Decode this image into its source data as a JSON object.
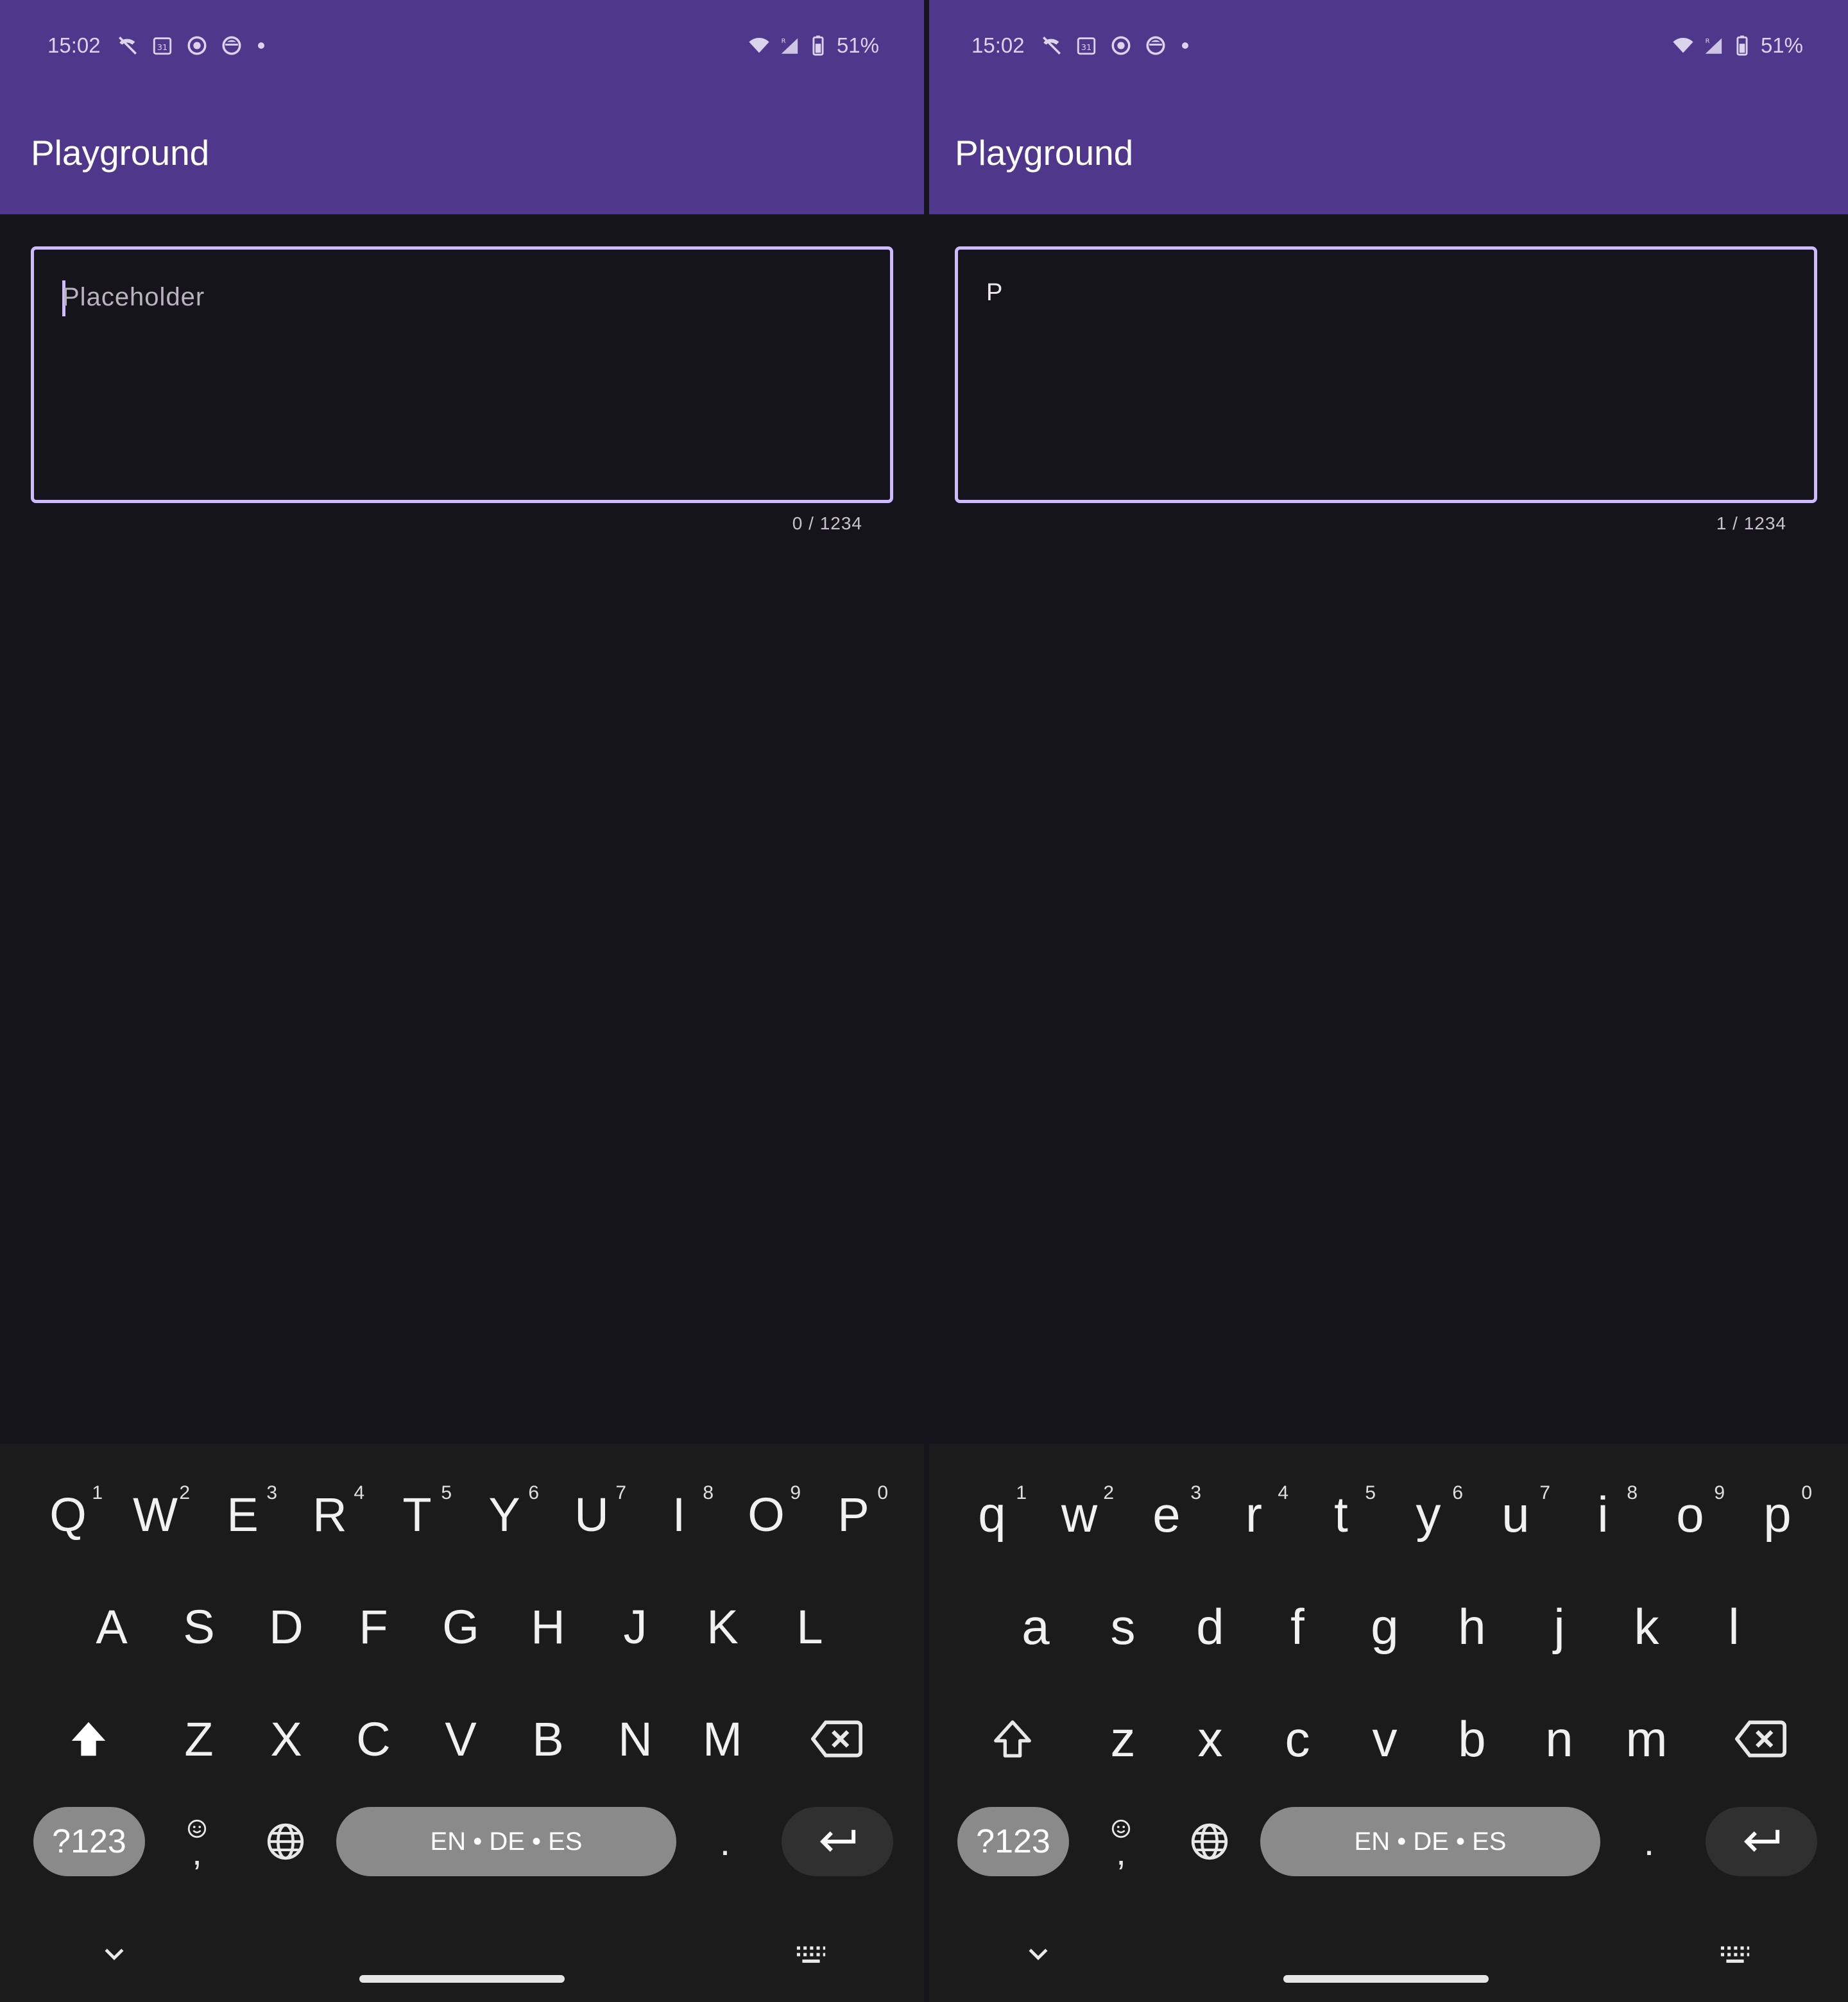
{
  "colors": {
    "app_bar": "#4f378b",
    "background": "#16141b",
    "field_border": "#cfbcff",
    "keyboard_bg": "#1b1b1b",
    "pill_gray": "#8a8a8a",
    "pill_dark": "#303030"
  },
  "panels": [
    {
      "status": {
        "time": "15:02",
        "battery": "51%",
        "icons": [
          "missed-call-icon",
          "calendar-icon",
          "sync-icon",
          "app-icon",
          "wifi-icon",
          "signal-icon",
          "battery-icon"
        ]
      },
      "app_title": "Playground",
      "field": {
        "placeholder": "Placeholder",
        "value": "",
        "counter": "0 / 1234"
      },
      "keyboard": {
        "row1": [
          {
            "k": "Q",
            "h": "1"
          },
          {
            "k": "W",
            "h": "2"
          },
          {
            "k": "E",
            "h": "3"
          },
          {
            "k": "R",
            "h": "4"
          },
          {
            "k": "T",
            "h": "5"
          },
          {
            "k": "Y",
            "h": "6"
          },
          {
            "k": "U",
            "h": "7"
          },
          {
            "k": "I",
            "h": "8"
          },
          {
            "k": "O",
            "h": "9"
          },
          {
            "k": "P",
            "h": "0"
          }
        ],
        "row2": [
          "A",
          "S",
          "D",
          "F",
          "G",
          "H",
          "J",
          "K",
          "L"
        ],
        "row3": [
          "Z",
          "X",
          "C",
          "V",
          "B",
          "N",
          "M"
        ],
        "symbols_label": "?123",
        "comma": ",",
        "space_label": "EN • DE • ES",
        "period": ".",
        "shift_state": "caps"
      }
    },
    {
      "status": {
        "time": "15:02",
        "battery": "51%",
        "icons": [
          "missed-call-icon",
          "calendar-icon",
          "sync-icon",
          "app-icon",
          "wifi-icon",
          "signal-icon",
          "battery-icon"
        ]
      },
      "app_title": "Playground",
      "field": {
        "placeholder": "",
        "value": "P",
        "counter": "1 / 1234"
      },
      "keyboard": {
        "row1": [
          {
            "k": "q",
            "h": "1"
          },
          {
            "k": "w",
            "h": "2"
          },
          {
            "k": "e",
            "h": "3"
          },
          {
            "k": "r",
            "h": "4"
          },
          {
            "k": "t",
            "h": "5"
          },
          {
            "k": "y",
            "h": "6"
          },
          {
            "k": "u",
            "h": "7"
          },
          {
            "k": "i",
            "h": "8"
          },
          {
            "k": "o",
            "h": "9"
          },
          {
            "k": "p",
            "h": "0"
          }
        ],
        "row2": [
          "a",
          "s",
          "d",
          "f",
          "g",
          "h",
          "j",
          "k",
          "l"
        ],
        "row3": [
          "z",
          "x",
          "c",
          "v",
          "b",
          "n",
          "m"
        ],
        "symbols_label": "?123",
        "comma": ",",
        "space_label": "EN • DE • ES",
        "period": ".",
        "shift_state": "off"
      }
    }
  ]
}
